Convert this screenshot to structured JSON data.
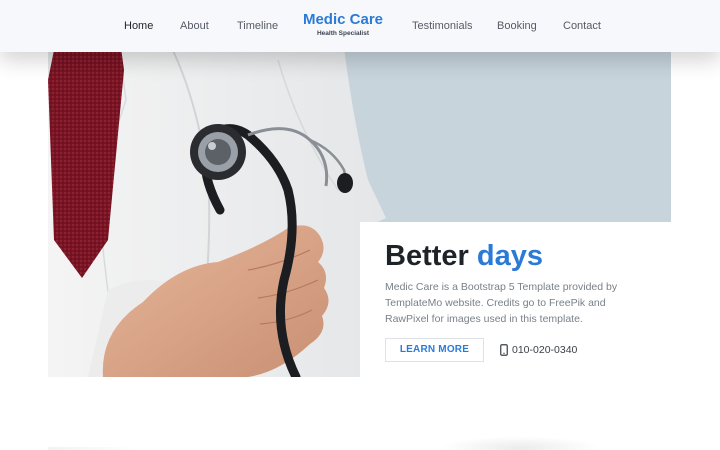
{
  "nav": {
    "items": [
      {
        "label": "Home",
        "active": true
      },
      {
        "label": "About"
      },
      {
        "label": "Timeline"
      },
      {
        "label": "Testimonials"
      },
      {
        "label": "Booking"
      },
      {
        "label": "Contact"
      }
    ],
    "brand": {
      "name": "Medic Care",
      "tagline": "Health Specialist"
    }
  },
  "hero": {
    "title_main": "Better",
    "title_accent": "days",
    "description": "Medic Care is a Bootstrap 5 Template provided by TemplateMo website. Credits go to FreePik and RawPixel for images used in this template.",
    "button_label": "LEARN MORE",
    "phone_icon": "mobile-phone-icon",
    "phone": "010-020-0340",
    "image_subject": "doctor-with-stethoscope"
  },
  "colors": {
    "accent": "#2b7bd6",
    "hero_background": "#c7d4dc",
    "navbar": "#f7f8fb",
    "heading": "#1e2229"
  }
}
